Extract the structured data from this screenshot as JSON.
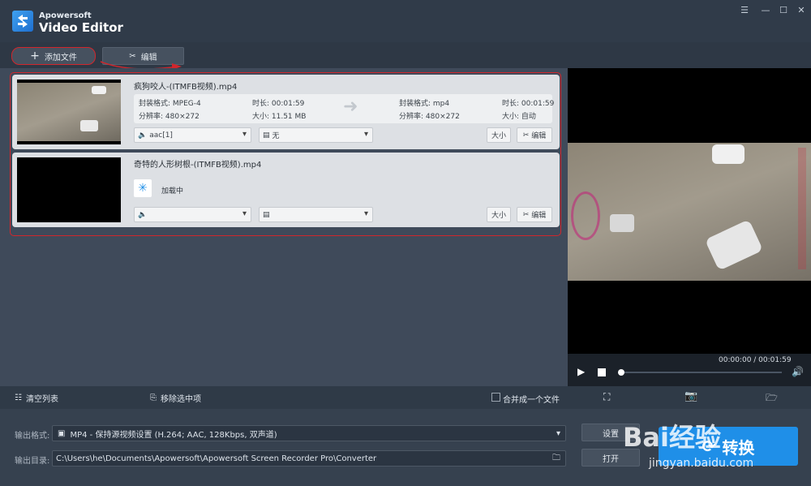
{
  "app": {
    "brand_small": "Apowersoft",
    "brand_big": "Video Editor"
  },
  "window": {
    "menu_icon": "menu-icon",
    "min": "—",
    "max": "☐",
    "close": "✕"
  },
  "toolbar": {
    "add_file": "添加文件",
    "edit": "编辑"
  },
  "files": [
    {
      "name": "疯狗咬人-(ITMFB视频).mp4",
      "src_format": "封装格式: MPEG-4",
      "src_duration": "时长: 00:01:59",
      "src_resolution": "分辨率: 480×272",
      "src_size": "大小: 11.51 MB",
      "dst_format": "封装格式: mp4",
      "dst_duration": "时长: 00:01:59",
      "dst_resolution": "分辨率: 480×272",
      "dst_size": "大小: 自动",
      "audio": "aac[1]",
      "subtitle": "无",
      "size_btn": "大小",
      "edit_btn": "编辑"
    },
    {
      "name": "奇特的人形树根-(ITMFB视频).mp4",
      "loading": "加载中",
      "audio": "",
      "subtitle": "",
      "size_btn": "大小",
      "edit_btn": "编辑"
    }
  ],
  "player": {
    "time": "00:00:00 / 00:01:59",
    "progress": 0
  },
  "bottom": {
    "clear_list": "清空列表",
    "remove_selected": "移除选中项",
    "merge": "合并成一个文件"
  },
  "output": {
    "format_label": "输出格式:",
    "format_value": "MP4 - 保持源视频设置 (H.264; AAC, 128Kbps, 双声道)",
    "dir_label": "输出目录:",
    "dir_value": "C:\\Users\\he\\Documents\\Apowersoft\\Apowersoft Screen Recorder Pro\\Converter",
    "settings_btn": "设置",
    "open_btn": "打开",
    "convert_btn": "转换"
  },
  "watermark": {
    "brand": "Bai经验",
    "url": "jingyan.baidu.com"
  },
  "colors": {
    "accent": "#1f8fe8",
    "annotation_red": "#d2262c"
  }
}
